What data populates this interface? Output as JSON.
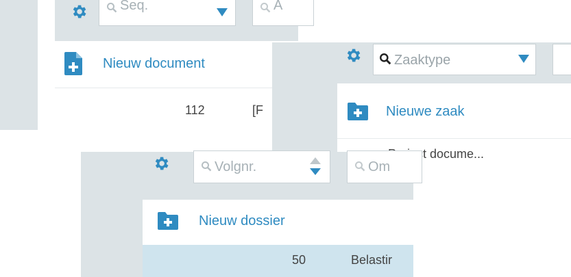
{
  "panel_documents": {
    "filter_sequence_placeholder": "Seq.",
    "filter_second_placeholder": "A",
    "new_button_label": "Nieuw document",
    "row": {
      "number": "112",
      "text": "[F"
    }
  },
  "panel_cases": {
    "filter_casetype_placeholder": "Zaaktype",
    "new_button_label": "Nieuwe zaak",
    "row": {
      "text": "Project docume..."
    }
  },
  "panel_dossiers": {
    "filter_volgnr_placeholder": "Volgnr.",
    "filter_second_placeholder": "Om",
    "new_button_label": "Nieuw dossier",
    "row": {
      "number": "50",
      "text": "Belastir"
    }
  },
  "colors": {
    "accent": "#2f8bc1",
    "toolbar_bg": "#dce3e6",
    "selected_row_bg": "#cfe4ee"
  }
}
